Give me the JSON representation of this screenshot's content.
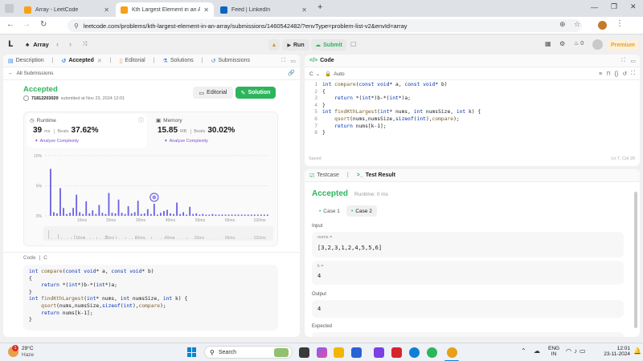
{
  "browser": {
    "tabs": [
      {
        "title": "Array - LeetCode",
        "active": false
      },
      {
        "title": "Kth Largest Element in an Array",
        "active": true
      },
      {
        "title": "Feed | LinkedIn",
        "active": false
      }
    ],
    "new_tab": "+",
    "url": "leetcode.com/problems/kth-largest-element-in-an-array/submissions/1460542482/?envType=problem-list-v2&envId=array"
  },
  "topbar": {
    "problem_list": "Array",
    "run": "Run",
    "submit": "Submit",
    "streak_count": "0",
    "premium": "Premium"
  },
  "left_tabs": [
    "Description",
    "Accepted",
    "Editorial",
    "Solutions",
    "Submissions"
  ],
  "all_submissions": "All Submissions",
  "submission": {
    "status": "Accepted",
    "user": "71812203020",
    "submitted_text": "submitted at Nov 23, 2024 12:01",
    "editorial_btn": "Editorial",
    "solution_btn": "Solution"
  },
  "runtime": {
    "label": "Runtime",
    "value": "39",
    "unit": "ms",
    "beats_label": "Beats",
    "beats": "37.62%",
    "analyze": "Analyze Complexity"
  },
  "memory": {
    "label": "Memory",
    "value": "15.85",
    "unit": "MB",
    "beats_label": "Beats",
    "beats": "30.02%",
    "analyze": "Analyze Complexity"
  },
  "chart_data": {
    "type": "bar",
    "y_ticks": [
      "10%",
      "5%",
      "0%"
    ],
    "x_ticks": [
      "10ms",
      "20ms",
      "30ms",
      "40ms",
      "55ms",
      "65ms",
      "192ms"
    ],
    "minimap_ticks": [
      "10ms",
      "20ms",
      "30ms",
      "40ms",
      "55ms",
      "65ms",
      "192ms"
    ],
    "ylim": [
      0,
      10
    ],
    "values": [
      7.8,
      0.6,
      0.4,
      4.6,
      1.3,
      0.3,
      0.5,
      1.3,
      3.5,
      0.6,
      0.3,
      2.4,
      0.4,
      0.9,
      0.3,
      1.8,
      0.5,
      0.3,
      3.8,
      0.5,
      0.4,
      2.7,
      0.5,
      0.3,
      1.6,
      0.4,
      0.6,
      2.5,
      0.3,
      0.4,
      1.1,
      0.3,
      2.0,
      0.2,
      0.5,
      0.8,
      1.0,
      0.4,
      0.3,
      2.2,
      0.3,
      0.6,
      0.2,
      1.5,
      0.3,
      0.4,
      0.2,
      0.3,
      0.2,
      0.2,
      0.3,
      0.2,
      0.2,
      0.2,
      0.2,
      0.2,
      0.2,
      0.2,
      0.2,
      0.2,
      0.2,
      0.2,
      0.2,
      0.2,
      0.2,
      0.2,
      0.2,
      0.2
    ],
    "highlight_index": 32,
    "bar_color": "#6b62e0"
  },
  "left_code": {
    "header": "Code",
    "lang": "C",
    "lines": [
      "int compare(const void* a, const void* b)",
      "{",
      "    return *(int*)b-*(int*)a;",
      "}",
      "int findKthLargest(int* nums, int numsSize, int k) {",
      "    qsort(nums,numsSize,sizeof(int),compare);",
      "    return nums[k-1];",
      "}"
    ]
  },
  "editor": {
    "header": "Code",
    "lang": "C",
    "mode": "Auto",
    "line_numbers": [
      "1",
      "2",
      "3",
      "4",
      "5",
      "6",
      "7",
      "8"
    ],
    "saved": "Saved",
    "cursor": "Ln 7, Col 20"
  },
  "result": {
    "tab_testcase": "Testcase",
    "tab_result": "Test Result",
    "status": "Accepted",
    "runtime": "Runtime: 0 ms",
    "cases": [
      "Case 1",
      "Case 2"
    ],
    "input_label": "Input",
    "param1_name": "nums =",
    "param1_value": "[3,2,3,1,2,4,5,5,6]",
    "param2_name": "k =",
    "param2_value": "4",
    "output_label": "Output",
    "output_value": "4",
    "expected_label": "Expected"
  },
  "taskbar": {
    "weather_temp": "29°C",
    "weather_desc": "Haze",
    "weather_badge": "1",
    "search": "Search",
    "lang1": "ENG",
    "lang2": "IN",
    "time": "12:01",
    "date": "23-11-2024"
  }
}
